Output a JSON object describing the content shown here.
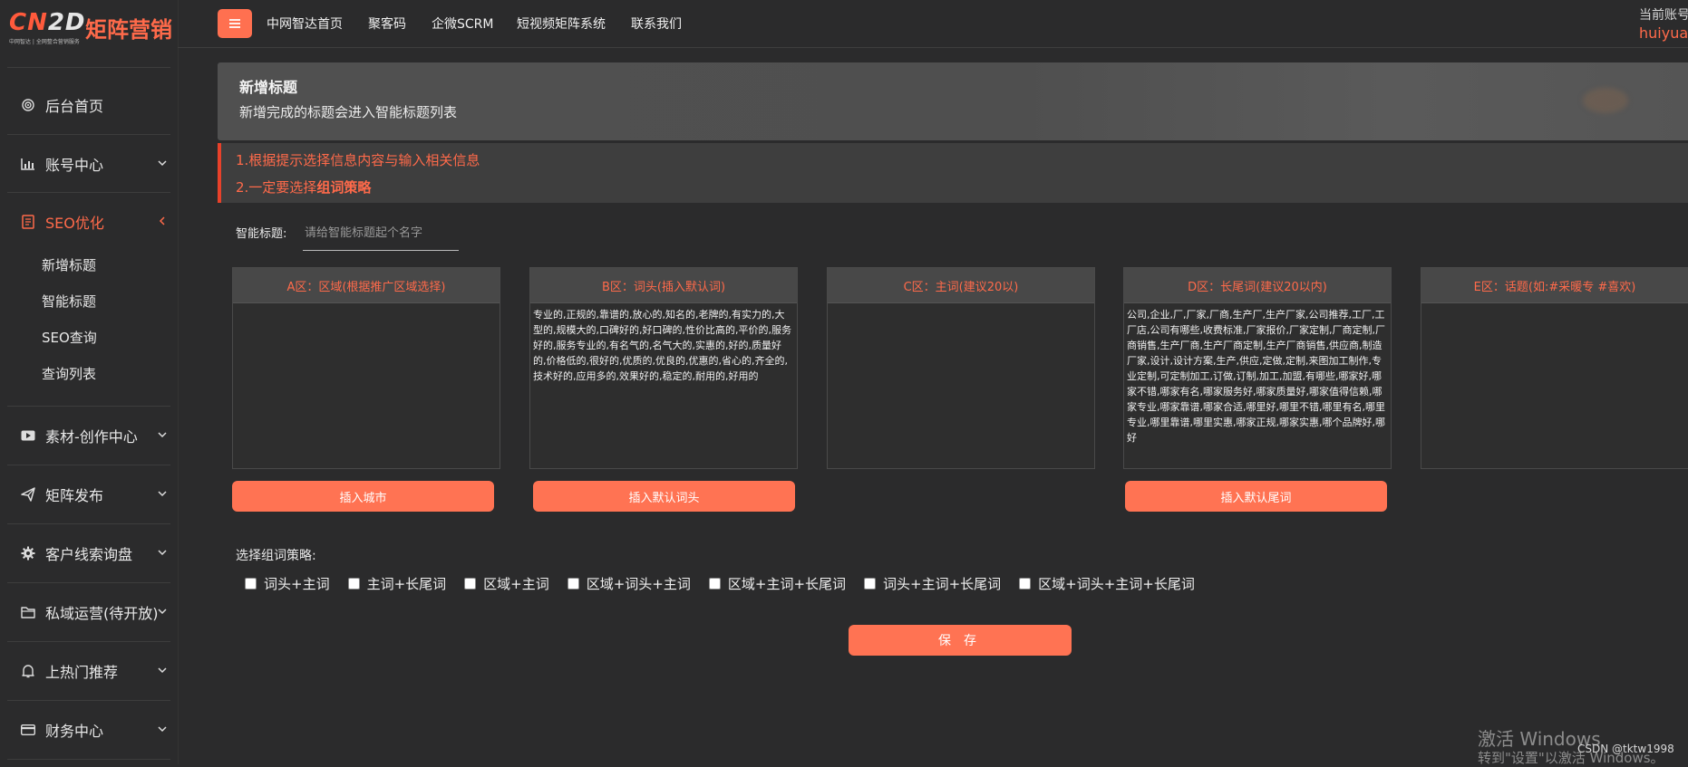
{
  "logo": {
    "mark_cn": "CN",
    "mark_2d": "2D",
    "brand": "矩阵营销",
    "tagline": "中网智达 | 全网整合营销服务"
  },
  "sidebar": {
    "items": [
      {
        "label": "后台首页",
        "icon": "target-icon"
      },
      {
        "label": "账号中心",
        "icon": "bar-chart-icon"
      },
      {
        "label": "SEO优化",
        "icon": "document-icon",
        "active": true
      },
      {
        "label": "素材-创作中心",
        "icon": "video-icon"
      },
      {
        "label": "矩阵发布",
        "icon": "send-icon"
      },
      {
        "label": "客户线索询盘",
        "icon": "gear-icon"
      },
      {
        "label": "私域运营(待开放)",
        "icon": "folder-icon"
      },
      {
        "label": "上热门推荐",
        "icon": "bell-icon"
      },
      {
        "label": "财务中心",
        "icon": "card-icon"
      }
    ],
    "seo_sub": [
      "新增标题",
      "智能标题",
      "SEO查询",
      "查询列表"
    ],
    "accent": "#ff6a4a"
  },
  "topnav": {
    "links": [
      "中网智达首页",
      "聚客码",
      "企微SCRM",
      "短视频矩阵系统",
      "联系我们"
    ],
    "user_label": "当前账号",
    "user_name": "huiyuan"
  },
  "header": {
    "title": "新增标题",
    "subtitle": "新增完成的标题会进入智能标题列表"
  },
  "notice": {
    "line1": "1.根据提示选择信息内容与输入相关信息",
    "line2_prefix": "2.一定要选择",
    "line2_bold": "组词策略"
  },
  "smart_title": {
    "label": "智能标题:",
    "placeholder": "请给智能标题起个名字"
  },
  "zones": [
    {
      "title": "A区：区域(根据推广区域选择)",
      "content": "",
      "button": "插入城市"
    },
    {
      "title": "B区：词头(插入默认词)",
      "content": "专业的,正规的,靠谱的,放心的,知名的,老牌的,有实力的,大型的,规模大的,口碑好的,好口碑的,性价比高的,平价的,服务好的,服务专业的,有名气的,名气大的,实惠的,好的,质量好的,价格低的,很好的,优质的,优良的,优惠的,省心的,齐全的,技术好的,应用多的,效果好的,稳定的,耐用的,好用的",
      "button": "插入默认词头"
    },
    {
      "title": "C区：主词(建议20以)",
      "content": "",
      "button": ""
    },
    {
      "title": "D区：长尾词(建议20以内)",
      "content": "公司,企业,厂,厂家,厂商,生产厂,生产厂家,公司推荐,工厂,工厂店,公司有哪些,收费标准,厂家报价,厂家定制,厂商定制,厂商销售,生产厂商,生产厂商定制,生产厂商销售,供应商,制造厂家,设计,设计方案,生产,供应,定做,定制,来图加工制作,专业定制,可定制加工,订做,订制,加工,加盟,有哪些,哪家好,哪家不错,哪家有名,哪家服务好,哪家质量好,哪家值得信赖,哪家专业,哪家靠谱,哪家合适,哪里好,哪里不错,哪里有名,哪里专业,哪里靠谱,哪里实惠,哪家正规,哪家实惠,哪个品牌好,哪好",
      "button": "插入默认尾词"
    },
    {
      "title": "E区：话题(如:#采暖专 #喜欢)",
      "content": "",
      "button": ""
    }
  ],
  "strategy": {
    "label": "选择组词策略:",
    "options": [
      "词头+主词",
      "主词+长尾词",
      "区域+主词",
      "区域+词头+主词",
      "区域+主词+长尾词",
      "词头+主词+长尾词",
      "区域+词头+主词+长尾词"
    ]
  },
  "save_label": "保存",
  "watermark": {
    "line1": "激活 Windows",
    "line2": "转到\"设置\"以激活 Windows。",
    "csdn": "CSDN @tktw1998"
  }
}
